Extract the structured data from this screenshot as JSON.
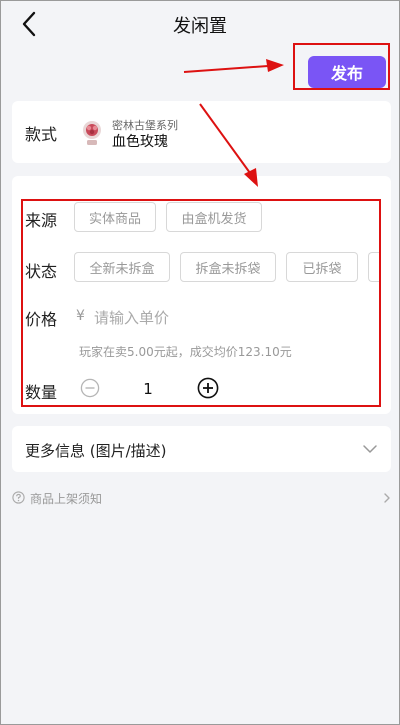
{
  "header": {
    "title": "发闲置"
  },
  "publish": {
    "label": "发布"
  },
  "style_section": {
    "label": "款式",
    "series": "密林古堡系列",
    "product_name": "血色玫瑰"
  },
  "source": {
    "label": "来源",
    "options": [
      "实体商品",
      "由盒机发货"
    ]
  },
  "condition": {
    "label": "状态",
    "options": [
      "全新未拆盒",
      "拆盒未拆袋",
      "已拆袋"
    ]
  },
  "price": {
    "label": "价格",
    "currency": "¥",
    "placeholder": "请输入单价",
    "hint": "玩家在卖5.00元起，成交均价123.10元"
  },
  "quantity": {
    "label": "数量",
    "value": "1"
  },
  "more_info": {
    "label": "更多信息 (图片/描述)"
  },
  "notice": {
    "label": "商品上架须知"
  },
  "colors": {
    "accent": "#7a55f5",
    "annotation": "#d11111"
  }
}
